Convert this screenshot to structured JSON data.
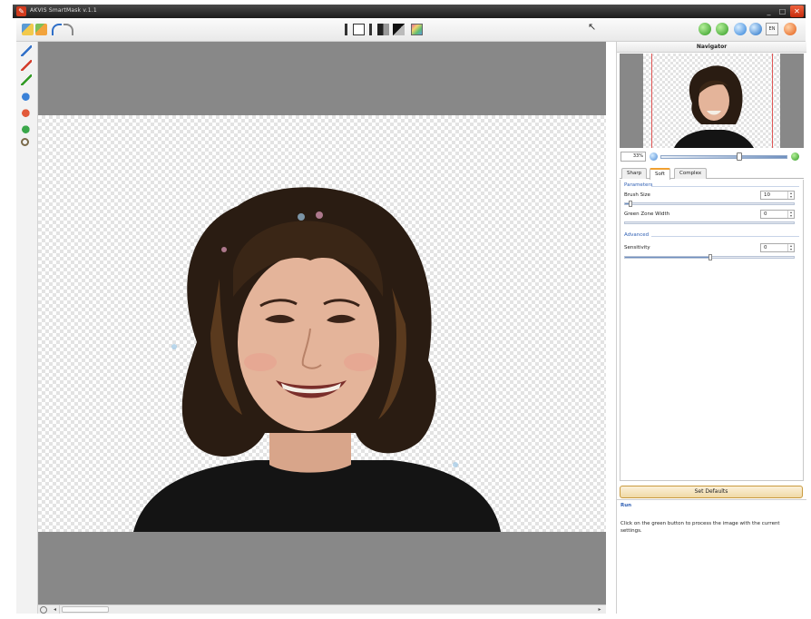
{
  "window": {
    "title": "AKVIS SmartMask v.1.1",
    "min_glyph": "_",
    "max_glyph": "□",
    "close_glyph": "✕"
  },
  "toolbar": {
    "language": "EN"
  },
  "navigator": {
    "title": "Navigator",
    "zoom_value": "33%"
  },
  "tabs": [
    {
      "label": "Sharp"
    },
    {
      "label": "Soft"
    },
    {
      "label": "Complex"
    }
  ],
  "parameters": {
    "section_label": "Parameters",
    "brush_size": {
      "label": "Brush Size",
      "value": "10"
    },
    "green_zone_width": {
      "label": "Green Zone Width",
      "value": "0"
    }
  },
  "advanced": {
    "section_label": "Advanced",
    "sensitivity": {
      "label": "Sensitivity",
      "value": "0"
    }
  },
  "defaults_button": "Set Defaults",
  "help": {
    "title": "Run",
    "text": "Click on the green button to process the image with the current settings."
  },
  "colors": {
    "title_bar": "#2a2a2a",
    "accent_blue": "#2f5fb3",
    "run_green": "#2f9a22",
    "canvas_gray": "#888888"
  },
  "icons": {
    "toolbar_left": [
      "open-icon",
      "save-icon",
      "undo-icon",
      "redo-icon"
    ],
    "view_modes": [
      "view-before-icon",
      "view-split-icon",
      "view-after-icon",
      "view-mask-icon",
      "view-bw-icon",
      "view-color-icon"
    ],
    "toolbar_right": [
      "back-icon",
      "run-icon",
      "info-icon",
      "globe-icon",
      "language-icon",
      "exit-icon"
    ],
    "tools": [
      "keep-pencil-icon",
      "remove-pencil-icon",
      "magic-pencil-icon",
      "blue-fill-icon",
      "red-fill-icon",
      "green-fill-icon",
      "zoom-icon"
    ]
  }
}
